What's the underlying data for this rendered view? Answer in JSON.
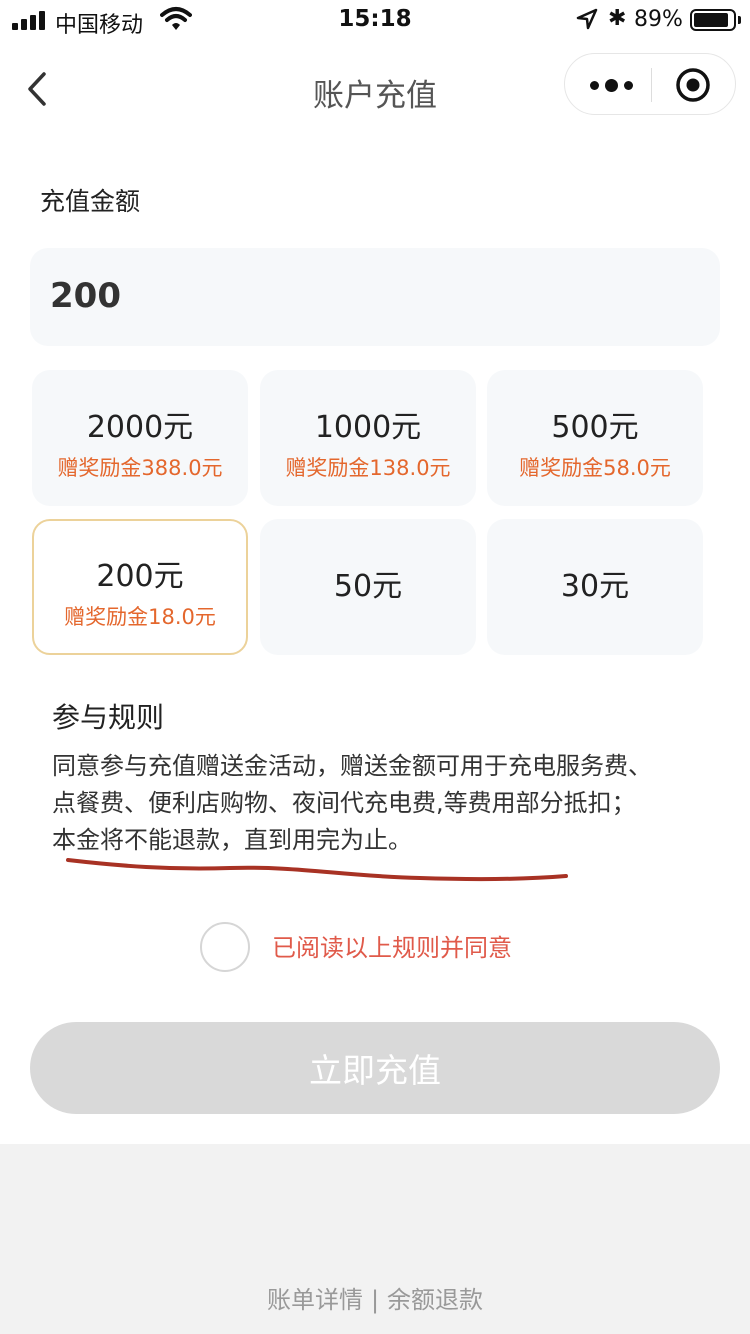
{
  "status_bar": {
    "carrier": "中国移动",
    "time": "15:18",
    "battery_percent": "89%",
    "battery_level": 0.89,
    "icons": [
      "signal-icon",
      "wifi-icon",
      "location-icon",
      "bluetooth-icon",
      "battery-icon"
    ]
  },
  "nav": {
    "title": "账户充值",
    "back_icon": "chevron-left-icon",
    "more_icon": "more-dots-icon",
    "close_icon": "target-circle-icon"
  },
  "amount": {
    "label": "充值金额",
    "value": "200"
  },
  "options": [
    {
      "value": "2000元",
      "bonus": "赠奖励金388.0元",
      "selected": false
    },
    {
      "value": "1000元",
      "bonus": "赠奖励金138.0元",
      "selected": false
    },
    {
      "value": "500元",
      "bonus": "赠奖励金58.0元",
      "selected": false
    },
    {
      "value": "200元",
      "bonus": "赠奖励金18.0元",
      "selected": true
    },
    {
      "value": "50元",
      "bonus": "",
      "selected": false
    },
    {
      "value": "30元",
      "bonus": "",
      "selected": false
    }
  ],
  "rules": {
    "title": "参与规则",
    "lines": [
      "同意参与充值赠送金活动，赠送金额可用于充电服务费、",
      "点餐费、便利店购物、夜间代充电费,等费用部分抵扣；",
      "本金将不能退款，直到用完为止。"
    ]
  },
  "agree": {
    "text": "已阅读以上规则并同意",
    "checked": false
  },
  "submit": {
    "label": "立即充值"
  },
  "footer": {
    "bill_details": "账单详情",
    "separator": "|",
    "balance_refund": "余额退款"
  },
  "colors": {
    "bonus_text": "#e4672d",
    "agree_text": "#e05a4a",
    "selected_border": "#ecd29a",
    "annotation": "#a83224",
    "button_disabled": "#d9d9d9"
  }
}
